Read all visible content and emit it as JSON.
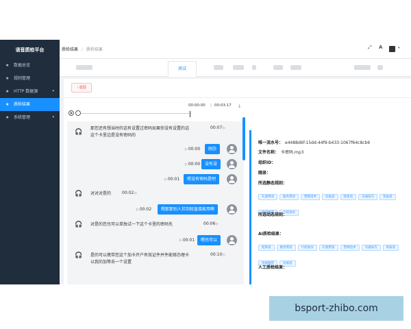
{
  "sidebar": {
    "title": "语音质检平台",
    "items": [
      {
        "label": "数据总览",
        "icon": "star-icon"
      },
      {
        "label": "规则管理",
        "icon": "star-icon"
      },
      {
        "label": "HTTP 数据源",
        "icon": "star-icon"
      },
      {
        "label": "质检结果",
        "icon": "star-icon",
        "active": true
      },
      {
        "label": "系统管理",
        "icon": "star-icon"
      }
    ]
  },
  "breadcrumb": [
    "质检结果",
    "质检结果"
  ],
  "topbar_icons": [
    "fullscreen-icon",
    "font-size-icon",
    "user-avatar-icon"
  ],
  "tabs": {
    "active_label": "测试"
  },
  "panel": {
    "back_label": "返回",
    "player": {
      "current_time": "00:00:00",
      "separator": "|",
      "total_time": "00:03:17"
    },
    "chat": [
      {
        "role": "customer",
        "lines": [
          "那您还有想当时的话有设置过密码如果你没有设置的话",
          "这个卡里边是没有密码的"
        ],
        "duration": "00:07"
      },
      {
        "role": "agent",
        "text": "刚办",
        "duration": "00:00"
      },
      {
        "role": "agent",
        "text": "没有没",
        "duration": "00:00"
      },
      {
        "role": "agent",
        "text": "嗯没有密码是吧",
        "duration": "00:01"
      },
      {
        "role": "customer",
        "lines": [
          "对对对是的"
        ],
        "duration": "00:02"
      },
      {
        "role": "agent",
        "text": "嗯那那别人捡到就直接能用啊",
        "duration": "00:02"
      },
      {
        "role": "customer",
        "lines": [
          "对是的您也可以单独试一下这个卡里的密码先"
        ],
        "duration": "00:06"
      },
      {
        "role": "agent",
        "text": "嗯也可以",
        "duration": "00:01"
      },
      {
        "role": "customer",
        "lines": [
          "是的可以携带您这个加卡开户有效证件并件能够办理卡",
          "以我的加等去一个设置"
        ],
        "duration": "00:10"
      }
    ],
    "info": {
      "serial_label": "唯一流水号：",
      "serial_value": "e4488d6f-15dd-44f9-b433-1067f64c8cb6",
      "filename_label": "文件名称：",
      "filename_value": "卡密码.mp3",
      "org_label": "组织ID：",
      "record_label": "随录：",
      "static_rules_label": "所选静态规则：",
      "static_rules": [
        "礼貌用语",
        "服务用语",
        "营销话术",
        "问候语",
        "结束语",
        "沟通技巧",
        "等候语",
        "违规推荐",
        "介绍身份"
      ],
      "dynamic_rules_label": "所选动态规则：",
      "ai_result_label": "AI质检结果：",
      "ai_results": [
        "结束语",
        "服务用语",
        "介绍身份",
        "礼貌用语",
        "营销话术",
        "沟通技巧",
        "等候语",
        "违规推荐",
        "问候语"
      ],
      "manual_result_label": "人工质检结果："
    }
  },
  "watermark": "bsport-zhibo.com"
}
